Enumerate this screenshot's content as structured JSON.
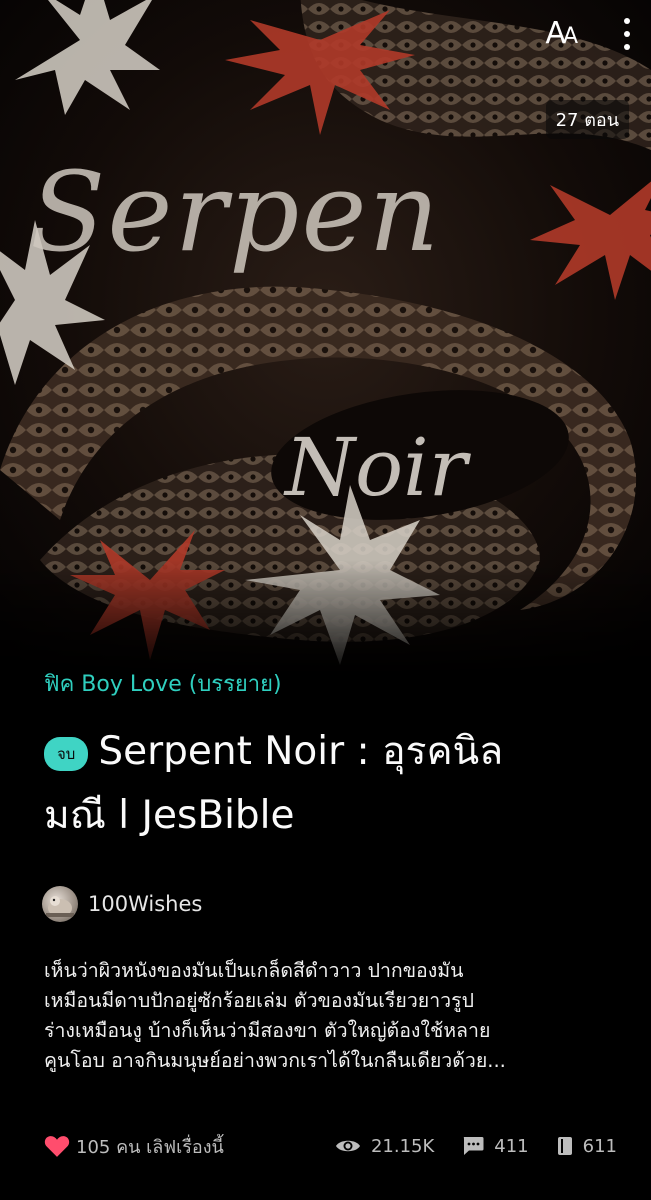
{
  "header": {
    "font_size_glyph_large": "A",
    "font_size_glyph_small": "A",
    "episode_count": "27 ตอน"
  },
  "cover": {
    "art_text_line1": "Serpen",
    "art_text_line2": "Noir"
  },
  "story": {
    "category": "ฟิค Boy Love (บรรยาย)",
    "status": "จบ",
    "title": "Serpent Noir : อุรคนิลมณี l JesBible",
    "title_line1": "Serpent Noir : อุรคนิล",
    "title_line2": "มณี l JesBible",
    "author": "100Wishes",
    "synopsis_lines": [
      "เห็นว่าผิวหนังของมันเป็นเกล็ดสีดำวาว ปากของมัน",
      "เหมือนมีดาบปักอยู่ซักร้อยเล่ม ตัวของมันเรียวยาวรูป",
      "ร่างเหมือนงู บ้างก็เห็นว่ามีสองขา ตัวใหญ่ต้องใช้หลาย",
      "คูนโอบ อาจกินมนุษย์อย่างพวกเราได้ในกลืนเดียวด้วย..."
    ]
  },
  "stats": {
    "likes": "105 คน เลิฟเรื่องนี้",
    "views": "21.15K",
    "comments": "411",
    "chapters": "611"
  },
  "colors": {
    "accent": "#2fcfbf",
    "badge": "#3fd4c4",
    "heart": "#ff4d6d",
    "background": "#000000"
  },
  "icons": [
    "font-size-icon",
    "more-icon",
    "heart-icon",
    "eye-icon",
    "comment-icon",
    "book-icon"
  ]
}
